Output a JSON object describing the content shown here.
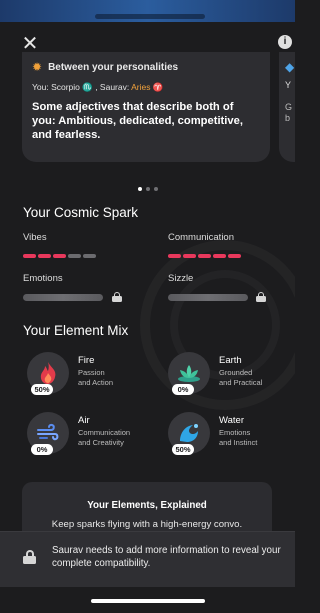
{
  "header": {
    "close_icon": "close-icon",
    "info_icon": "info-icon",
    "info_glyph": "i"
  },
  "card": {
    "title": "Between your personalities",
    "signs_prefix": "You: Scorpio ♏ , Saurav: ",
    "signs_aries": "Aries ♈",
    "body": "Some adjectives that describe both of you: Ambitious, dedicated, competitive, and fearless."
  },
  "card_peek": {
    "line1": "Y",
    "line2": "G",
    "line3": "b"
  },
  "carousel": {
    "total": 3,
    "active": 0
  },
  "cosmic_spark": {
    "title": "Your Cosmic Spark",
    "vibes": {
      "label": "Vibes",
      "level": 3,
      "max": 5
    },
    "communication": {
      "label": "Communication",
      "level": 5,
      "max": 5
    },
    "emotions": {
      "label": "Emotions",
      "locked": true
    },
    "sizzle": {
      "label": "Sizzle",
      "locked": true
    }
  },
  "element_mix": {
    "title": "Your Element Mix",
    "elements": [
      {
        "name": "Fire",
        "desc1": "Passion",
        "desc2": "and Action",
        "percent": "50%",
        "icon": "fire-icon"
      },
      {
        "name": "Earth",
        "desc1": "Grounded",
        "desc2": "and Practical",
        "percent": "0%",
        "icon": "earth-lotus-icon"
      },
      {
        "name": "Air",
        "desc1": "Communication",
        "desc2": "and Creativity",
        "percent": "0%",
        "icon": "air-wind-icon"
      },
      {
        "name": "Water",
        "desc1": "Emotions",
        "desc2": "and Instinct",
        "percent": "50%",
        "icon": "water-wave-icon"
      }
    ]
  },
  "explained": {
    "title": "Your Elements, Explained",
    "subtitle": "Keep sparks flying with a high-energy convo."
  },
  "notice": {
    "text": "Saurav needs to add more information to reveal your complete compatibility."
  },
  "colors": {
    "accent_pink": "#e8385c",
    "aries_orange": "#f2a23c",
    "background": "#1c1c1e",
    "card": "#2d2d31"
  }
}
